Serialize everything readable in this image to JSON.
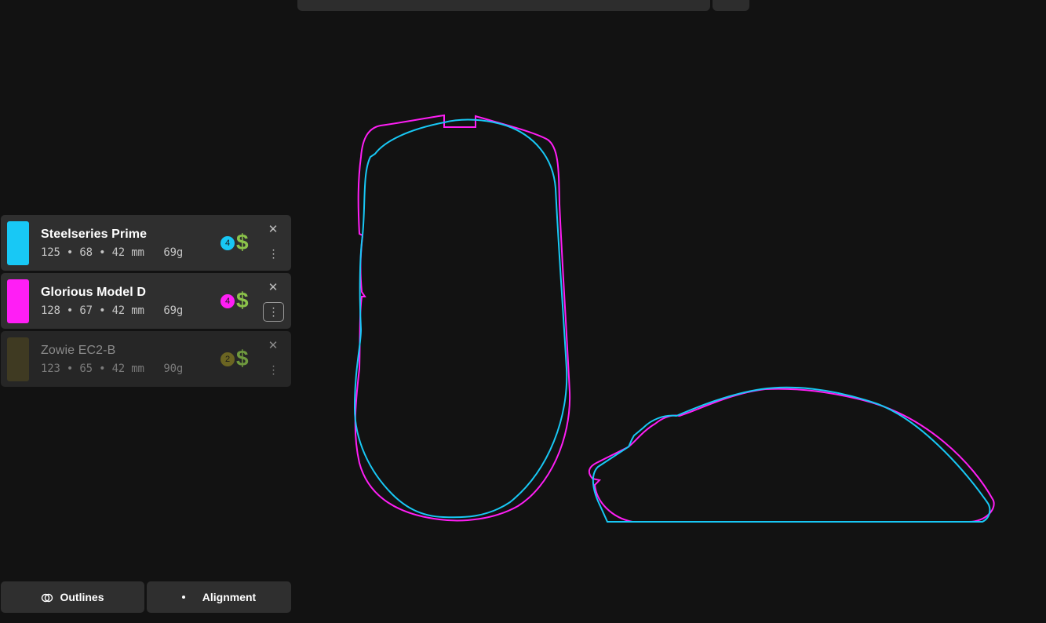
{
  "mice": [
    {
      "name": "Steelseries Prime",
      "length": "125",
      "width": "68",
      "height": "42",
      "unit": "mm",
      "weight": "69g",
      "badge": "4",
      "price_symbol": "$",
      "color": "#18c8f5",
      "badge_color": "#18c8f5",
      "close_glyph": "✕",
      "more_glyph": "⋮",
      "state": "visible"
    },
    {
      "name": "Glorious Model D",
      "length": "128",
      "width": "67",
      "height": "42",
      "unit": "mm",
      "weight": "69g",
      "badge": "4",
      "price_symbol": "$",
      "color": "#ff1ef5",
      "badge_color": "#ff1ef5",
      "close_glyph": "✕",
      "more_glyph": "⋮",
      "state": "visible-menu-focused"
    },
    {
      "name": "Zowie EC2-B",
      "length": "123",
      "width": "65",
      "height": "42",
      "unit": "mm",
      "weight": "90g",
      "badge": "2",
      "price_symbol": "$",
      "color": "#3f3a22",
      "badge_color": "#6b6522",
      "close_glyph": "✕",
      "more_glyph": "⋮",
      "state": "hidden"
    }
  ],
  "separator": "•",
  "bottom": {
    "outlines_label": "Outlines",
    "alignment_label": "Alignment"
  },
  "outline_colors": {
    "steelseries": "#18c8f5",
    "glorious": "#ff1ef5"
  },
  "icons": {
    "outlines": "overlapping-circles-icon",
    "alignment": "dot-icon",
    "close": "close-icon",
    "more": "more-vertical-icon"
  }
}
